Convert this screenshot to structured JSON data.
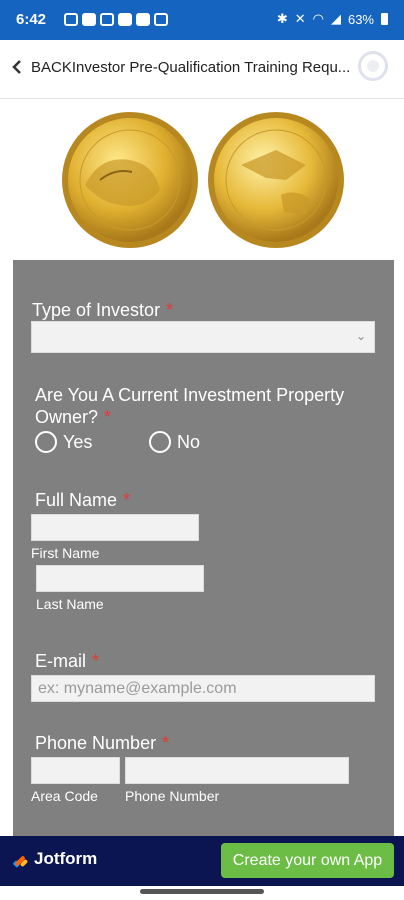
{
  "status_bar": {
    "time": "6:42",
    "battery": "63%"
  },
  "header": {
    "back_icon": "chevron-left-icon",
    "title": "BACKInvestor Pre-Qualification Training Requ..."
  },
  "images": {
    "coins": "gold-eagle-coins"
  },
  "form": {
    "investor_type": {
      "label": "Type of Investor",
      "required": "*",
      "value": ""
    },
    "property_owner": {
      "label": "Are You A Current Investment Property Owner?",
      "required": "*",
      "options": [
        "Yes",
        "No"
      ]
    },
    "full_name": {
      "label": "Full Name",
      "required": "*",
      "first_label": "First Name",
      "last_label": "Last Name"
    },
    "email": {
      "label": "E-mail",
      "required": "*",
      "placeholder": "ex: myname@example.com"
    },
    "phone": {
      "label": "Phone Number",
      "required": "*",
      "area_label": "Area Code",
      "number_label": "Phone Number"
    }
  },
  "footer": {
    "brand": "Jotform",
    "cta": "Create your own App"
  },
  "colors": {
    "status_bar": "#1565c0",
    "form_panel": "#808080",
    "required": "#e53935",
    "footer": "#0a1551",
    "cta": "#6cbd45"
  }
}
